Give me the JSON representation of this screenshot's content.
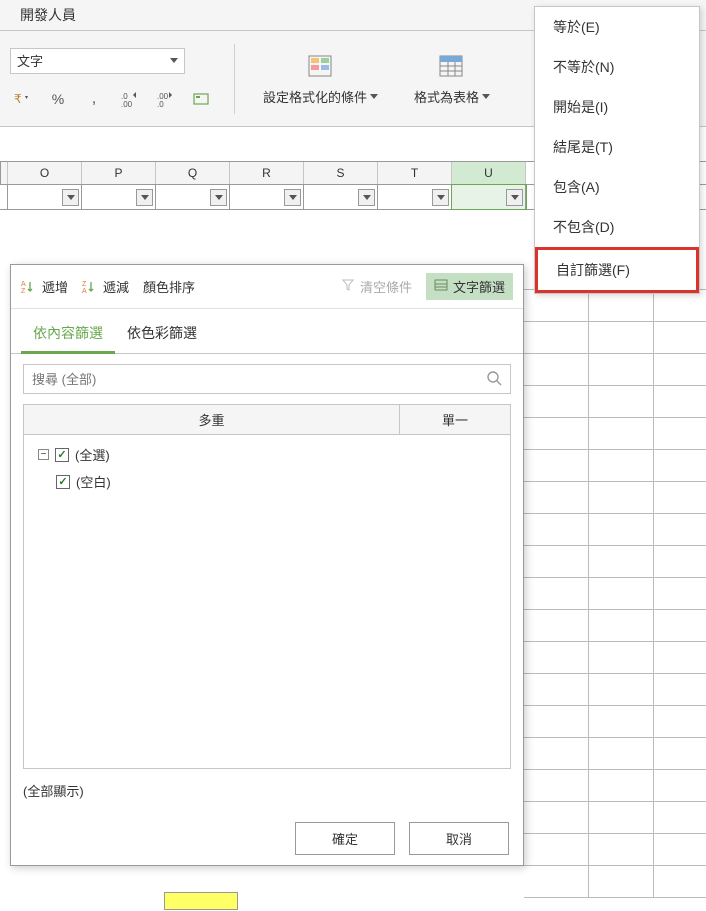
{
  "ribbon": {
    "tab": "開發人員",
    "text_dropdown": "文字",
    "conditional_fmt": "設定格式化的條件",
    "as_table": "格式為表格"
  },
  "columns": [
    "O",
    "P",
    "Q",
    "R",
    "S",
    "T",
    "U"
  ],
  "active_col": "U",
  "menu": {
    "equals": "等於(E)",
    "not_equals": "不等於(N)",
    "begins": "開始是(I)",
    "ends": "結尾是(T)",
    "contains": "包含(A)",
    "not_contains": "不包含(D)",
    "custom": "自訂篩選(F)"
  },
  "panel": {
    "sort_asc": "遞增",
    "sort_desc": "遞減",
    "color_sort": "顏色排序",
    "clear": "清空條件",
    "text_filter": "文字篩選",
    "tab_content": "依內容篩選",
    "tab_color": "依色彩篩選",
    "search_placeholder": "搜尋 (全部)",
    "col_multi": "多重",
    "col_single": "單一",
    "items": [
      {
        "label": "(全選)",
        "checked": true
      },
      {
        "label": "(空白)",
        "checked": true
      }
    ],
    "show_all": "(全部顯示)",
    "ok": "確定",
    "cancel": "取消"
  }
}
